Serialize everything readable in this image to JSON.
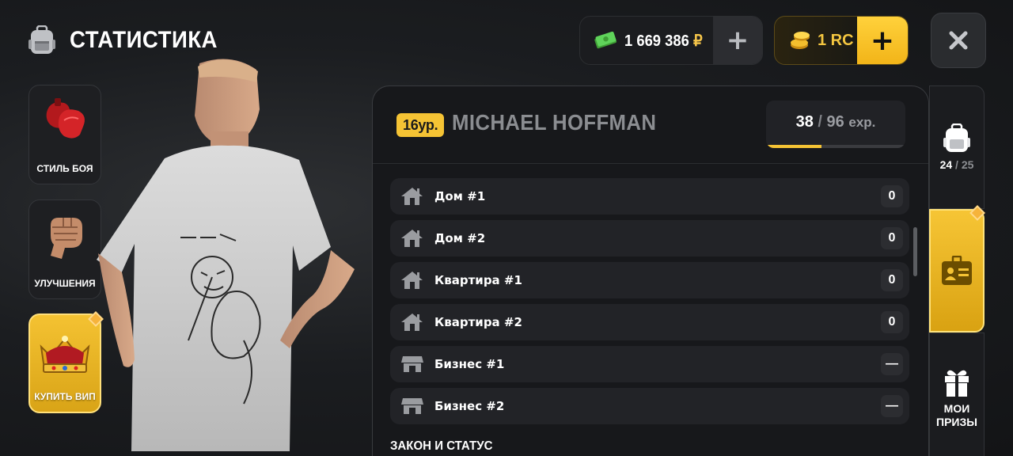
{
  "header": {
    "title": "СТАТИСТИКА",
    "money_value": "1 669 386",
    "money_symbol": "₽",
    "money_plus": "+",
    "rc_value": "1 RC",
    "rc_plus": "+"
  },
  "side_menu": [
    {
      "label": "СТИЛЬ БОЯ",
      "icon": "boxing-gloves-icon"
    },
    {
      "label": "УЛУЧШЕНИЯ",
      "icon": "fist-icon"
    },
    {
      "label": "КУПИТЬ ВИП",
      "icon": "crown-icon"
    }
  ],
  "player": {
    "level": "16ур.",
    "name": "MICHAEL HOFFMAN",
    "exp_current": "38",
    "exp_sep": "/",
    "exp_total": "96",
    "exp_unit": "exp.",
    "exp_progress": 0.396
  },
  "property_rows": [
    {
      "label": "Дом #1",
      "value": "0",
      "icon": "house-icon"
    },
    {
      "label": "Дом #2",
      "value": "0",
      "icon": "house-icon"
    },
    {
      "label": "Квартира #1",
      "value": "0",
      "icon": "house-icon"
    },
    {
      "label": "Квартира #2",
      "value": "0",
      "icon": "house-icon"
    },
    {
      "label": "Бизнес #1",
      "value": "—",
      "icon": "shop-icon"
    },
    {
      "label": "Бизнес #2",
      "value": "—",
      "icon": "shop-icon"
    }
  ],
  "section_title": "ЗАКОН И СТАТУС",
  "right_tabs": {
    "inventory_count": "24",
    "inventory_sep": "/",
    "inventory_total": "25",
    "prizes_label_1": "МОИ",
    "prizes_label_2": "ПРИЗЫ"
  },
  "colors": {
    "accent": "#f5c334",
    "panel": "#17181b",
    "row": "#222327",
    "money_green": "#5fd35a"
  }
}
